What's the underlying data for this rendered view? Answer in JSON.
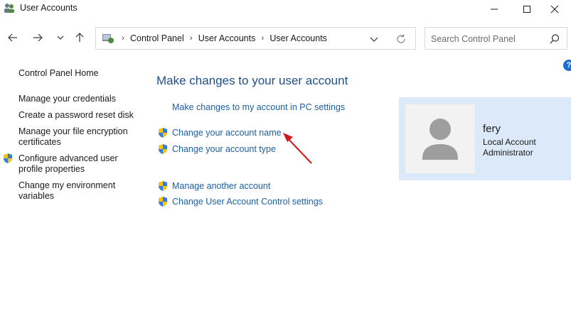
{
  "window": {
    "title": "User Accounts",
    "controls": {
      "minimize": "minimize-icon",
      "maximize": "maximize-icon",
      "close": "close-icon"
    }
  },
  "nav": {
    "breadcrumbs": [
      "Control Panel",
      "User Accounts",
      "User Accounts"
    ],
    "search_placeholder": "Search Control Panel",
    "search_value": ""
  },
  "sidebar": {
    "items": [
      {
        "label": "Control Panel Home",
        "shield": false
      },
      {
        "label": "Manage your credentials",
        "shield": false
      },
      {
        "label": "Create a password reset disk",
        "shield": false
      },
      {
        "label": "Manage your file encryption certificates",
        "shield": false
      },
      {
        "label": "Configure advanced user profile properties",
        "shield": true
      },
      {
        "label": "Change my environment variables",
        "shield": false
      }
    ]
  },
  "main": {
    "heading": "Make changes to your user account",
    "links": [
      {
        "label": "Make changes to my account in PC settings",
        "shield": false
      },
      {
        "label": "Change your account name",
        "shield": true
      },
      {
        "label": "Change your account type",
        "shield": true
      },
      {
        "label": "Manage another account",
        "shield": true
      },
      {
        "label": "Change User Account Control settings",
        "shield": true
      }
    ]
  },
  "account": {
    "name": "fery",
    "type": "Local Account",
    "role": "Administrator"
  },
  "colors": {
    "link": "#1b5fa6",
    "heading": "#1e4e8c",
    "card_bg": "#dbe9f8",
    "annotation_arrow": "#d0191f",
    "help_badge": "#1e6fd0"
  }
}
